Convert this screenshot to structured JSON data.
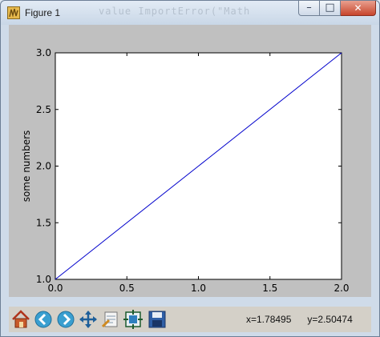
{
  "window": {
    "title": "Figure 1",
    "ghost_text": "value ImportError(\"Math"
  },
  "chart_data": {
    "type": "line",
    "x": [
      0.0,
      1.0,
      2.0
    ],
    "series": [
      {
        "values": [
          1.0,
          2.0,
          3.0
        ],
        "color": "#0000cc"
      }
    ],
    "xlabel": "",
    "ylabel": "some numbers",
    "xlim": [
      0.0,
      2.0
    ],
    "ylim": [
      1.0,
      3.0
    ],
    "xticks": [
      "0.0",
      "0.5",
      "1.0",
      "1.5",
      "2.0"
    ],
    "yticks": [
      "1.0",
      "1.5",
      "2.0",
      "2.5",
      "3.0"
    ],
    "grid": false
  },
  "toolbar": {
    "buttons": [
      "home-icon",
      "back-icon",
      "forward-icon",
      "pan-icon",
      "zoom-icon",
      "subplots-icon",
      "save-icon"
    ],
    "x_readout": "x=1.78495",
    "y_readout": "y=2.50474"
  },
  "colors": {
    "plot_background": "#c0c0c0",
    "axes_background": "#ffffff",
    "line": "#0000cc"
  }
}
